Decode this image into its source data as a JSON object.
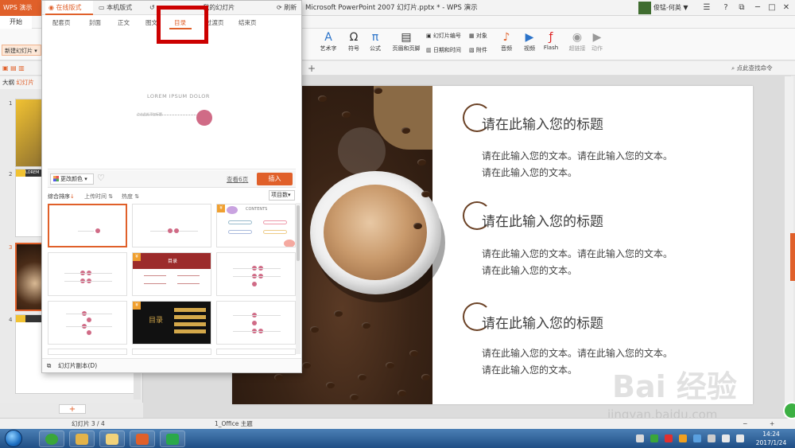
{
  "app": {
    "tab_label": "WPS 演示",
    "doc_title": "Microsoft PowerPoint 2007 幻灯片.pptx * - WPS 演示",
    "user": "俊锰-何英 ▼",
    "menu_start": "开始"
  },
  "ribbon": {
    "art_text": "艺术字",
    "symbol": "符号",
    "formula": "公式",
    "header_footer": "页眉和页脚",
    "slide_number": "幻灯片编号",
    "object": "对象",
    "date_time": "日期和时间",
    "attachment": "附件",
    "audio": "音频",
    "video": "视频",
    "flash": "Flash",
    "hyperlink": "超链接",
    "action": "动作",
    "new_slide": "新建幻灯片",
    "outline_tab": "大纲",
    "slides_tab": "幻灯片",
    "view_link": "点此查找命令"
  },
  "popup": {
    "tabs": {
      "online": "在线版式",
      "local": "本机版式",
      "mine": "我的幻灯片",
      "refresh": "刷新"
    },
    "categories": [
      "配套页",
      "封面",
      "正文",
      "图文",
      "目录",
      "过渡页",
      "结束页"
    ],
    "preview_title": "LOREM IPSUM DOLOR",
    "preview_subtitle": "点击此处添加标题",
    "change_color": "更改颜色",
    "view_pages": "查看6页",
    "insert": "插入",
    "sort": {
      "all": "综合排序",
      "upload_time": "上传时间",
      "popularity": "热度",
      "item_count": "项目数"
    },
    "contents_label": "CONTENTS",
    "mulu_label": "目录",
    "footer": "幻灯片副本(D)"
  },
  "slide": {
    "title_1": "请在此输入您的标题",
    "body_1a": "请在此输入您的文本。请在此输入您的文本。",
    "body_1b": "请在此输入您的文本。",
    "title_2": "请在此输入您的标题",
    "body_2a": "请在此输入您的文本。请在此输入您的文本。",
    "body_2b": "请在此输入您的文本。",
    "title_3": "请在此输入您的标题",
    "body_3a": "请在此输入您的文本。请在此输入您的文本。",
    "body_3b": "请在此输入您的文本。",
    "thumb_caption": "LOREM"
  },
  "thumbs": {
    "numbers": [
      "1",
      "2",
      "3",
      "4"
    ]
  },
  "status": {
    "slide_counter": "幻灯片 3 / 4",
    "theme": "1_Office 主题"
  },
  "taskbar": {
    "time": "14:24",
    "date": "2017/1/24"
  },
  "watermark": {
    "brand": "Bai 经验",
    "url": "jingyan.baidu.com"
  },
  "colors": {
    "accent": "#e0602a",
    "highlight_box": "#cc0000",
    "circle": "#6b4226",
    "dot": "#d06b86"
  }
}
